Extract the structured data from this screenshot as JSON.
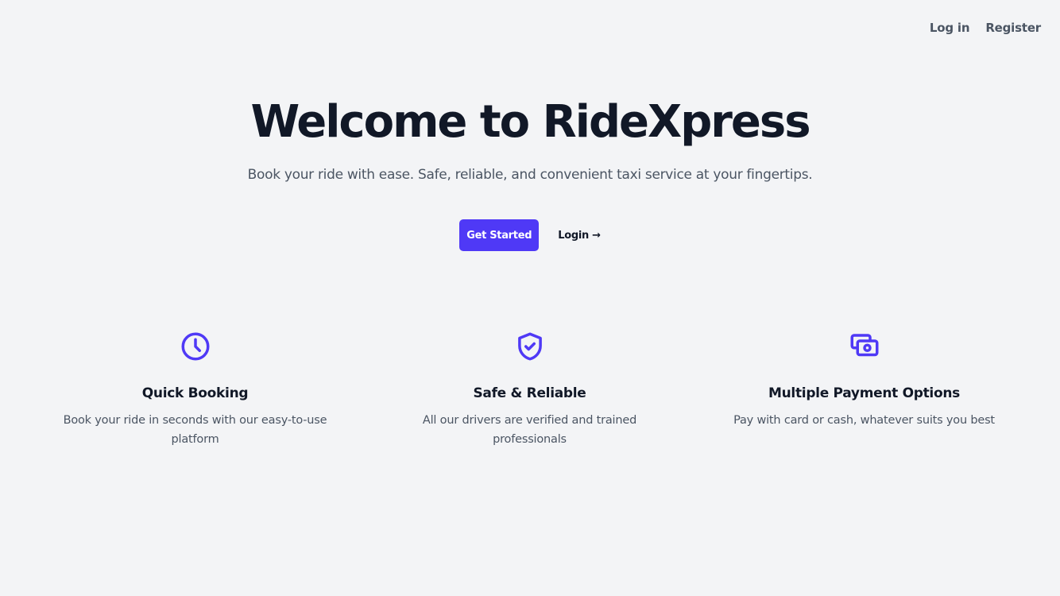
{
  "nav": {
    "login": "Log in",
    "register": "Register"
  },
  "hero": {
    "title": "Welcome to RideXpress",
    "subtitle": "Book your ride with ease. Safe, reliable, and convenient taxi service at your fingertips."
  },
  "cta": {
    "primary": "Get Started",
    "secondary": "Login →"
  },
  "features": [
    {
      "icon": "clock-icon",
      "title": "Quick Booking",
      "description": "Book your ride in seconds with our easy-to-use platform"
    },
    {
      "icon": "shield-check-icon",
      "title": "Safe & Reliable",
      "description": "All our drivers are verified and trained professionals"
    },
    {
      "icon": "cash-icon",
      "title": "Multiple Payment Options",
      "description": "Pay with card or cash, whatever suits you best"
    }
  ],
  "colors": {
    "accent": "#4f39f6",
    "background": "#f3f4f6",
    "heading": "#111827",
    "body_text": "#4b5563"
  }
}
